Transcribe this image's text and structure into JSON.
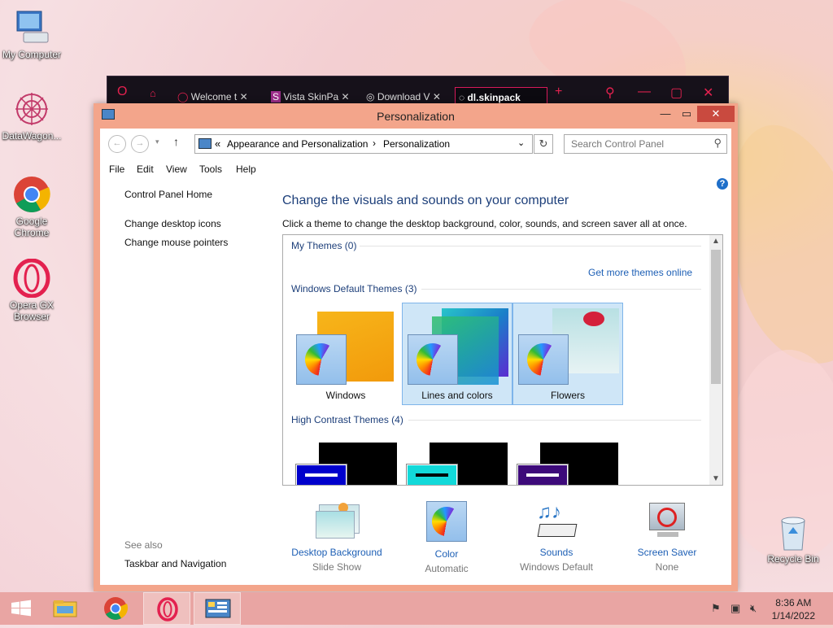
{
  "desktop": {
    "icons": [
      {
        "label": "My Computer"
      },
      {
        "label": "DataWagon..."
      },
      {
        "label": "Google Chrome"
      },
      {
        "label": "Opera GX Browser"
      },
      {
        "label": "Recycle Bin"
      }
    ]
  },
  "browser": {
    "tabs": [
      {
        "label": "Welcome t"
      },
      {
        "label": "Vista SkinPa"
      },
      {
        "label": "Download V"
      },
      {
        "label": "dl.skinpack"
      }
    ],
    "new_tab": "+"
  },
  "window": {
    "title": "Personalization",
    "minimize": "—",
    "maximize": "▭",
    "close": "✕",
    "address": {
      "overflow": "«",
      "crumbs": [
        "Appearance and Personalization",
        "Personalization"
      ],
      "sep": "›"
    },
    "search_placeholder": "Search Control Panel",
    "menu": [
      "File",
      "Edit",
      "View",
      "Tools",
      "Help"
    ],
    "left_pane": {
      "home": "Control Panel Home",
      "links": [
        "Change desktop icons",
        "Change mouse pointers"
      ],
      "see_also": "See also",
      "see_also_links": [
        "Taskbar and Navigation"
      ]
    },
    "heading": "Change the visuals and sounds on your computer",
    "subheading": "Click a theme to change the desktop background, color, sounds, and screen saver all at once.",
    "themes": {
      "my_themes": "My Themes (0)",
      "get_more": "Get more themes online",
      "default_group": "Windows Default Themes (3)",
      "default": [
        {
          "name": "Windows",
          "selected": false
        },
        {
          "name": "Lines and colors",
          "selected": true
        },
        {
          "name": "Flowers",
          "selected": true
        }
      ],
      "high_contrast_group": "High Contrast Themes (4)",
      "high_contrast_colors": [
        "#0000cc",
        "#12d9d9",
        "#3d0a7a"
      ]
    },
    "bottom": [
      {
        "label": "Desktop Background",
        "sub": "Slide Show"
      },
      {
        "label": "Color",
        "sub": "Automatic"
      },
      {
        "label": "Sounds",
        "sub": "Windows Default"
      },
      {
        "label": "Screen Saver",
        "sub": "None"
      }
    ],
    "help": "?"
  },
  "taskbar": {
    "time": "8:36 AM",
    "date": "1/14/2022"
  },
  "colors": {
    "window_frame": "#f3a58b",
    "link": "#1d5fb5",
    "heading": "#1d3f7a",
    "taskbar": "#e9a5a3",
    "opera_red": "#e3214f"
  }
}
